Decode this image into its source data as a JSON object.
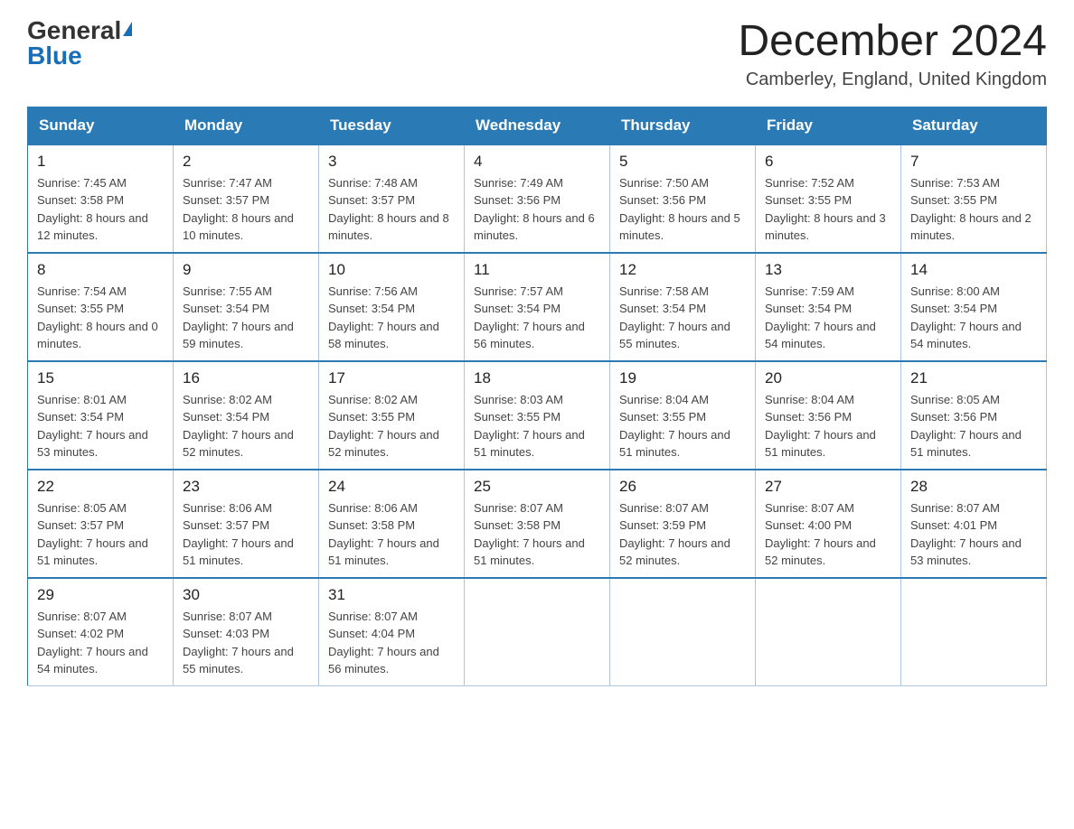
{
  "header": {
    "logo_general": "General",
    "logo_blue": "Blue",
    "title": "December 2024",
    "subtitle": "Camberley, England, United Kingdom"
  },
  "days_of_week": [
    "Sunday",
    "Monday",
    "Tuesday",
    "Wednesday",
    "Thursday",
    "Friday",
    "Saturday"
  ],
  "weeks": [
    [
      {
        "day": "1",
        "sunrise": "7:45 AM",
        "sunset": "3:58 PM",
        "daylight": "8 hours and 12 minutes."
      },
      {
        "day": "2",
        "sunrise": "7:47 AM",
        "sunset": "3:57 PM",
        "daylight": "8 hours and 10 minutes."
      },
      {
        "day": "3",
        "sunrise": "7:48 AM",
        "sunset": "3:57 PM",
        "daylight": "8 hours and 8 minutes."
      },
      {
        "day": "4",
        "sunrise": "7:49 AM",
        "sunset": "3:56 PM",
        "daylight": "8 hours and 6 minutes."
      },
      {
        "day": "5",
        "sunrise": "7:50 AM",
        "sunset": "3:56 PM",
        "daylight": "8 hours and 5 minutes."
      },
      {
        "day": "6",
        "sunrise": "7:52 AM",
        "sunset": "3:55 PM",
        "daylight": "8 hours and 3 minutes."
      },
      {
        "day": "7",
        "sunrise": "7:53 AM",
        "sunset": "3:55 PM",
        "daylight": "8 hours and 2 minutes."
      }
    ],
    [
      {
        "day": "8",
        "sunrise": "7:54 AM",
        "sunset": "3:55 PM",
        "daylight": "8 hours and 0 minutes."
      },
      {
        "day": "9",
        "sunrise": "7:55 AM",
        "sunset": "3:54 PM",
        "daylight": "7 hours and 59 minutes."
      },
      {
        "day": "10",
        "sunrise": "7:56 AM",
        "sunset": "3:54 PM",
        "daylight": "7 hours and 58 minutes."
      },
      {
        "day": "11",
        "sunrise": "7:57 AM",
        "sunset": "3:54 PM",
        "daylight": "7 hours and 56 minutes."
      },
      {
        "day": "12",
        "sunrise": "7:58 AM",
        "sunset": "3:54 PM",
        "daylight": "7 hours and 55 minutes."
      },
      {
        "day": "13",
        "sunrise": "7:59 AM",
        "sunset": "3:54 PM",
        "daylight": "7 hours and 54 minutes."
      },
      {
        "day": "14",
        "sunrise": "8:00 AM",
        "sunset": "3:54 PM",
        "daylight": "7 hours and 54 minutes."
      }
    ],
    [
      {
        "day": "15",
        "sunrise": "8:01 AM",
        "sunset": "3:54 PM",
        "daylight": "7 hours and 53 minutes."
      },
      {
        "day": "16",
        "sunrise": "8:02 AM",
        "sunset": "3:54 PM",
        "daylight": "7 hours and 52 minutes."
      },
      {
        "day": "17",
        "sunrise": "8:02 AM",
        "sunset": "3:55 PM",
        "daylight": "7 hours and 52 minutes."
      },
      {
        "day": "18",
        "sunrise": "8:03 AM",
        "sunset": "3:55 PM",
        "daylight": "7 hours and 51 minutes."
      },
      {
        "day": "19",
        "sunrise": "8:04 AM",
        "sunset": "3:55 PM",
        "daylight": "7 hours and 51 minutes."
      },
      {
        "day": "20",
        "sunrise": "8:04 AM",
        "sunset": "3:56 PM",
        "daylight": "7 hours and 51 minutes."
      },
      {
        "day": "21",
        "sunrise": "8:05 AM",
        "sunset": "3:56 PM",
        "daylight": "7 hours and 51 minutes."
      }
    ],
    [
      {
        "day": "22",
        "sunrise": "8:05 AM",
        "sunset": "3:57 PM",
        "daylight": "7 hours and 51 minutes."
      },
      {
        "day": "23",
        "sunrise": "8:06 AM",
        "sunset": "3:57 PM",
        "daylight": "7 hours and 51 minutes."
      },
      {
        "day": "24",
        "sunrise": "8:06 AM",
        "sunset": "3:58 PM",
        "daylight": "7 hours and 51 minutes."
      },
      {
        "day": "25",
        "sunrise": "8:07 AM",
        "sunset": "3:58 PM",
        "daylight": "7 hours and 51 minutes."
      },
      {
        "day": "26",
        "sunrise": "8:07 AM",
        "sunset": "3:59 PM",
        "daylight": "7 hours and 52 minutes."
      },
      {
        "day": "27",
        "sunrise": "8:07 AM",
        "sunset": "4:00 PM",
        "daylight": "7 hours and 52 minutes."
      },
      {
        "day": "28",
        "sunrise": "8:07 AM",
        "sunset": "4:01 PM",
        "daylight": "7 hours and 53 minutes."
      }
    ],
    [
      {
        "day": "29",
        "sunrise": "8:07 AM",
        "sunset": "4:02 PM",
        "daylight": "7 hours and 54 minutes."
      },
      {
        "day": "30",
        "sunrise": "8:07 AM",
        "sunset": "4:03 PM",
        "daylight": "7 hours and 55 minutes."
      },
      {
        "day": "31",
        "sunrise": "8:07 AM",
        "sunset": "4:04 PM",
        "daylight": "7 hours and 56 minutes."
      },
      null,
      null,
      null,
      null
    ]
  ],
  "labels": {
    "sunrise": "Sunrise:",
    "sunset": "Sunset:",
    "daylight": "Daylight:"
  }
}
